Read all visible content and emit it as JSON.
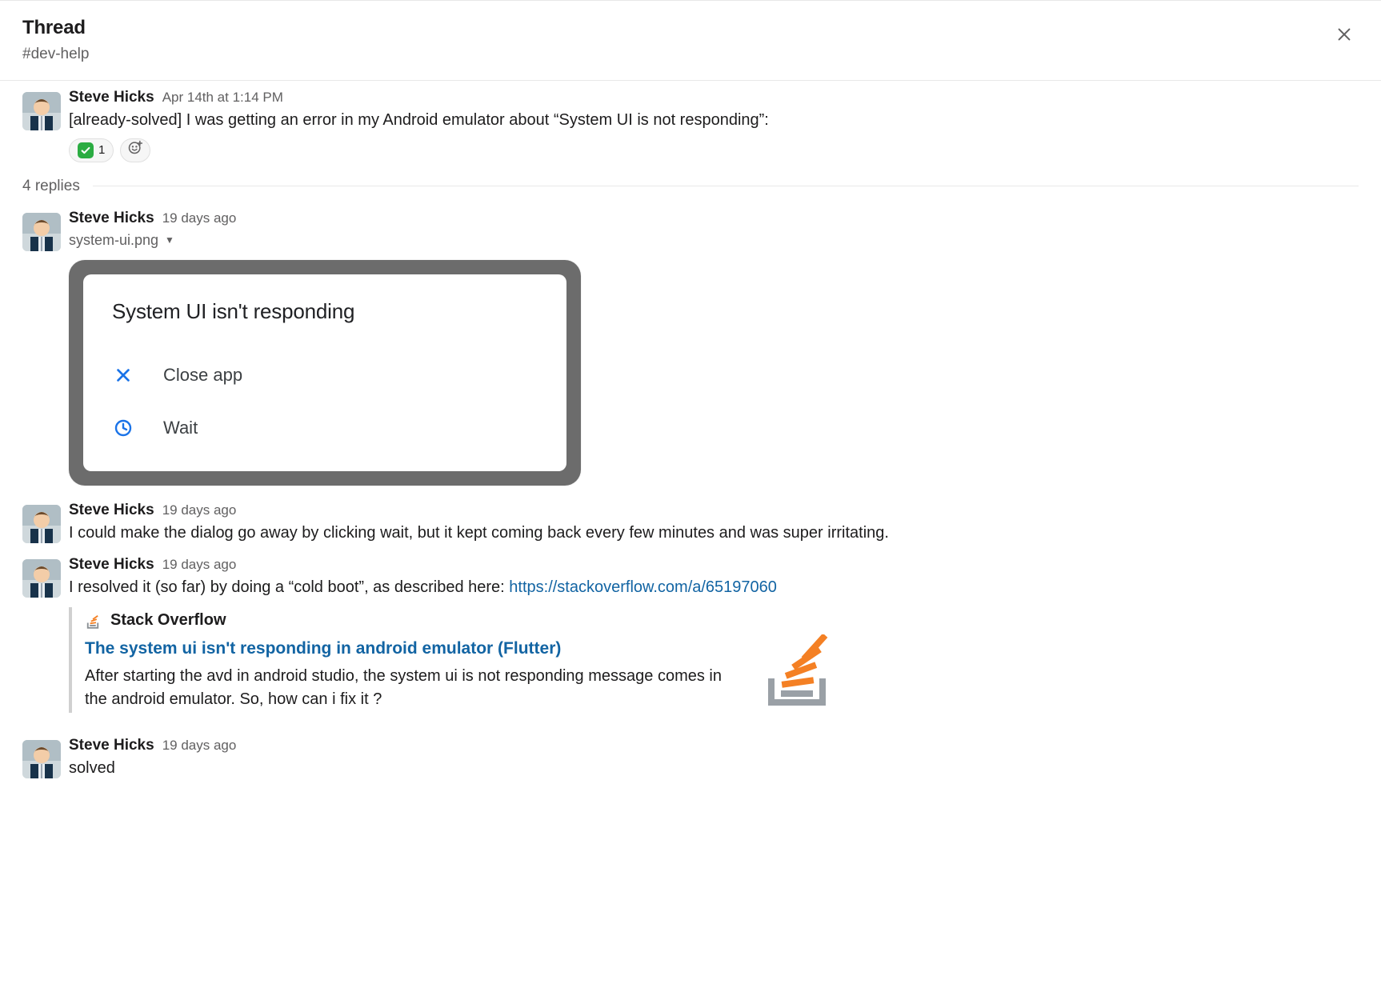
{
  "header": {
    "title": "Thread",
    "channel": "#dev-help"
  },
  "parent": {
    "author": "Steve Hicks",
    "timestamp": "Apr 14th at 1:14 PM",
    "text": "[already-solved] I was getting an error in my Android emulator about “System UI is not responding”:",
    "reaction_count": "1"
  },
  "replies_label": "4 replies",
  "replies": [
    {
      "author": "Steve Hicks",
      "timestamp": "19 days ago",
      "file_name": "system-ui.png",
      "android": {
        "title": "System UI isn't responding",
        "close": "Close app",
        "wait": "Wait"
      }
    },
    {
      "author": "Steve Hicks",
      "timestamp": "19 days ago",
      "text": "I could make the dialog go away by clicking wait, but it kept coming back every few minutes and was super irritating."
    },
    {
      "author": "Steve Hicks",
      "timestamp": "19 days ago",
      "text_pre": "I resolved it (so far) by doing a “cold boot”, as described here: ",
      "link_text": "https://stackoverflow.com/a/65197060",
      "unfurl": {
        "site": "Stack Overflow",
        "title": "The system ui isn't responding in android emulator (Flutter)",
        "desc": "After starting the avd in android studio, the system ui is not responding message comes in the android emulator. So, how can i fix it ?"
      }
    },
    {
      "author": "Steve Hicks",
      "timestamp": "19 days ago",
      "text": "solved"
    }
  ]
}
